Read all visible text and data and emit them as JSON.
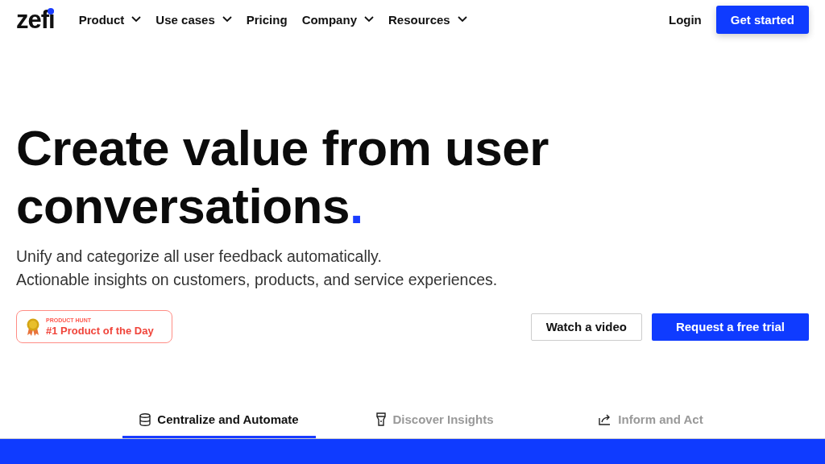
{
  "nav": {
    "logo": "zefi",
    "items": [
      {
        "label": "Product",
        "dropdown": true
      },
      {
        "label": "Use cases",
        "dropdown": true
      },
      {
        "label": "Pricing",
        "dropdown": false
      },
      {
        "label": "Company",
        "dropdown": true
      },
      {
        "label": "Resources",
        "dropdown": true
      }
    ],
    "login": "Login",
    "cta": "Get started"
  },
  "hero": {
    "headline": "Create value from user conversations",
    "accent": ".",
    "subtitle": [
      "Unify and categorize all user feedback automatically.",
      "Actionable insights on customers, products, and service experiences."
    ],
    "badge": {
      "eyebrow": "PRODUCT HUNT",
      "title": "#1 Product of the Day"
    },
    "buttons": [
      {
        "label": "Watch a video",
        "kind": "secondary"
      },
      {
        "label": "Request a free trial",
        "kind": "primary"
      }
    ]
  },
  "tabs": [
    {
      "label": "Centralize and Automate",
      "kind": "database",
      "selected": true
    },
    {
      "label": "Discover Insights",
      "kind": "flashlight",
      "selected": false
    },
    {
      "label": "Inform and Act",
      "kind": "share",
      "selected": false
    }
  ]
}
